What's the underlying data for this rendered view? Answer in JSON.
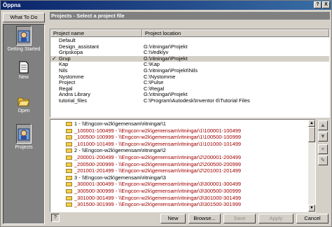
{
  "window": {
    "title": "Öppna",
    "help_glyph": "?",
    "close_glyph": "X"
  },
  "sidebar": {
    "header": "What To Do",
    "items": [
      {
        "label": "Getting Started",
        "icon": "getting-started-icon",
        "selected": true
      },
      {
        "label": "New",
        "icon": "new-document-icon",
        "selected": false
      },
      {
        "label": "Open",
        "icon": "open-folder-icon",
        "selected": false
      },
      {
        "label": "Projects",
        "icon": "projects-icon",
        "selected": true
      }
    ]
  },
  "projects": {
    "group_label": "Projects - Select a project file",
    "columns": [
      "Project name",
      "Project location"
    ],
    "check_glyph": "✓",
    "rows": [
      {
        "name": "Default",
        "location": ""
      },
      {
        "name": "Design_assistant",
        "location": "G:\\ritningar\\Projekt"
      },
      {
        "name": "Gripskopa",
        "location": "C:\\Vedklyv"
      },
      {
        "name": "Grup",
        "location": "G:\\ritningar\\Projekt",
        "selected": true
      },
      {
        "name": "Kap",
        "location": "C:\\Kap"
      },
      {
        "name": "Nils",
        "location": "G:\\ritningar\\Projekt\\Nils"
      },
      {
        "name": "Nystomme",
        "location": "C:\\Nystomme"
      },
      {
        "name": "Project",
        "location": "C:\\Pulse"
      },
      {
        "name": "Regal",
        "location": "C:\\Regal"
      },
      {
        "name": "Andra Library",
        "location": "G:\\ritningar\\Projekt"
      },
      {
        "name": "tutorial_files",
        "location": "C:\\Program\\Autodesk\\Inventor 6\\Tutorial Files"
      }
    ]
  },
  "folders": {
    "rows": [
      {
        "text": "1 - \\\\Engcon-w2k\\gemensam\\ritningar\\1",
        "kind": "group"
      },
      {
        "text": "_100001-100499 - \\\\Engcon-w2k\\gemensam\\ritningar\\1\\100001-100499",
        "kind": "sub"
      },
      {
        "text": "_100500-100999 - \\\\Engcon-w2k\\gemensam\\ritningar\\1\\100500-100999",
        "kind": "sub"
      },
      {
        "text": "_101000-101499 - \\\\Engcon-w2k\\gemensam\\ritningar\\1\\101000-101499",
        "kind": "sub"
      },
      {
        "text": "2 - \\\\Engcon-w2k\\gemensam\\ritningar\\2",
        "kind": "group"
      },
      {
        "text": "_200001-200499 - \\\\Engcon-w2k\\gemensam\\ritningar\\2\\200001-200499",
        "kind": "sub"
      },
      {
        "text": "_200500-200999 - \\\\Engcon-w2k\\gemensam\\ritningar\\2\\200500-200999",
        "kind": "sub"
      },
      {
        "text": "_201001-201499 - \\\\Engcon-w2k\\gemensam\\ritningar\\2\\201001-201499",
        "kind": "sub"
      },
      {
        "text": "3 - \\\\Engcon-w2k\\gemensam\\ritningar\\3",
        "kind": "group"
      },
      {
        "text": "_300001-300499 - \\\\Engcon-w2k\\gemensam\\ritningar\\3\\300001-300499",
        "kind": "sub"
      },
      {
        "text": "_300500-300999 - \\\\Engcon-w2k\\gemensam\\ritningar\\3\\300500-300999",
        "kind": "sub"
      },
      {
        "text": "_301000-301499 - \\\\Engcon-w2k\\gemensam\\ritningar\\3\\301000-301499",
        "kind": "sub"
      },
      {
        "text": "_301500-301999 - \\\\Engcon-w2k\\gemensam\\ritningar\\3\\301500-301999",
        "kind": "sub"
      }
    ]
  },
  "side_buttons": [
    "▲",
    "▼",
    "+",
    "✎"
  ],
  "buttons": {
    "help": "?",
    "new": "New",
    "browse": "Browse...",
    "save": "Save",
    "apply": "Apply",
    "cancel": "Cancel"
  },
  "colors": {
    "title_bar": "#0a246a",
    "folder_sub_text": "#a00000",
    "sidebar_bg": "#808080"
  }
}
